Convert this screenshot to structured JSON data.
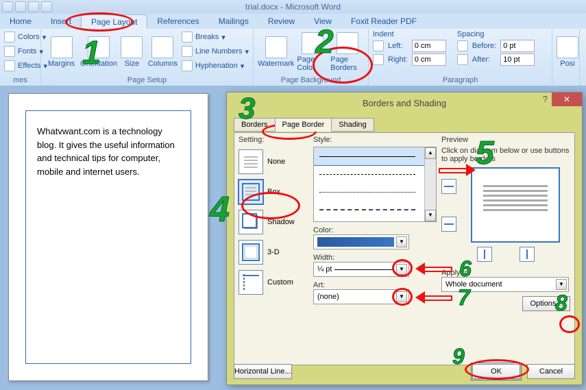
{
  "title": {
    "filename": "trial.docx",
    "app": "Microsoft Word"
  },
  "tabs": [
    "Home",
    "Insert",
    "Page Layout",
    "References",
    "Mailings",
    "Review",
    "View",
    "Foxit Reader PDF"
  ],
  "active_tab": 2,
  "themes": {
    "colors": "Colors",
    "fonts": "Fonts",
    "effects": "Effects",
    "label": "mes"
  },
  "pagesetup": {
    "margins": "Margins",
    "orientation": "Orientation",
    "size": "Size",
    "columns": "Columns",
    "breaks": "Breaks",
    "linenumbers": "Line Numbers",
    "hyphenation": "Hyphenation",
    "label": "Page Setup"
  },
  "pagebg": {
    "watermark": "Watermark",
    "pagecolor": "Page Color",
    "pageborders": "Page Borders",
    "label": "Page Background"
  },
  "indent": {
    "head": "Indent",
    "left": "Left:",
    "right": "Right:",
    "left_val": "0 cm",
    "right_val": "0 cm"
  },
  "spacing": {
    "head": "Spacing",
    "before": "Before:",
    "after": "After:",
    "before_val": "0 pt",
    "after_val": "10 pt"
  },
  "paragraph_label": "Paragraph",
  "posi": "Posi",
  "doc_text": "Whatvwant.com is a technology blog. It gives the useful information and technical tips for computer, mobile and internet users.",
  "dialog": {
    "title": "Borders and Shading",
    "tabs": [
      "Borders",
      "Page Border",
      "Shading"
    ],
    "active_tab": 1,
    "setting_label": "Setting:",
    "settings": [
      "None",
      "Box",
      "Shadow",
      "3-D",
      "Custom"
    ],
    "selected_setting": 1,
    "style_label": "Style:",
    "color_label": "Color:",
    "width_label": "Width:",
    "width_value": "¼ pt",
    "art_label": "Art:",
    "art_value": "(none)",
    "preview_label": "Preview",
    "preview_hint": "Click on diagram below or use buttons to apply borders",
    "applyto_label": "Apply to:",
    "applyto_value": "Whole document",
    "options": "Options...",
    "hline": "Horizontal Line...",
    "ok": "OK",
    "cancel": "Cancel",
    "help": "?"
  },
  "annotations": {
    "n1": "1",
    "n2": "2",
    "n3": "3",
    "n4": "4",
    "n5": "5",
    "n6": "6",
    "n7": "7",
    "n8": "8",
    "n9": "9"
  }
}
